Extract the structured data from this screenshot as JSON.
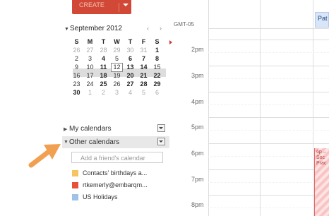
{
  "create_button": {
    "label": "CREATE"
  },
  "mini_calendar": {
    "title": "September 2012",
    "prev": "‹",
    "next": "›",
    "weekdays": [
      "S",
      "M",
      "T",
      "W",
      "T",
      "F",
      "S"
    ],
    "weeks": [
      [
        "26",
        "27",
        "28",
        "29",
        "30",
        "31",
        "1"
      ],
      [
        "2",
        "3",
        "4",
        "5",
        "6",
        "7",
        "8"
      ],
      [
        "9",
        "10",
        "11",
        "12",
        "13",
        "14",
        "15"
      ],
      [
        "16",
        "17",
        "18",
        "19",
        "20",
        "21",
        "22"
      ],
      [
        "23",
        "24",
        "25",
        "26",
        "27",
        "28",
        "29"
      ],
      [
        "30",
        "1",
        "2",
        "3",
        "4",
        "5",
        "6"
      ]
    ],
    "today": "12"
  },
  "sidebar": {
    "my_calendars": "My calendars",
    "other_calendars": "Other calendars",
    "add_friend_placeholder": "Add a friend's calendar",
    "calendars": [
      {
        "name": "Contacts' birthdays a...",
        "color": "#f5c561"
      },
      {
        "name": "rtkemerly@embarqm...",
        "color": "#e7513a"
      },
      {
        "name": "US Holidays",
        "color": "#9fc3e7"
      }
    ]
  },
  "grid": {
    "timezone": "GMT-05",
    "hours": [
      "2pm",
      "3pm",
      "4pm",
      "5pm",
      "6pm",
      "7pm",
      "8pm"
    ],
    "event_top": "Pat",
    "event_bottom": "6p – Soc Prac"
  },
  "colors": {
    "create": "#d14836",
    "arrow": "#f0a050"
  }
}
